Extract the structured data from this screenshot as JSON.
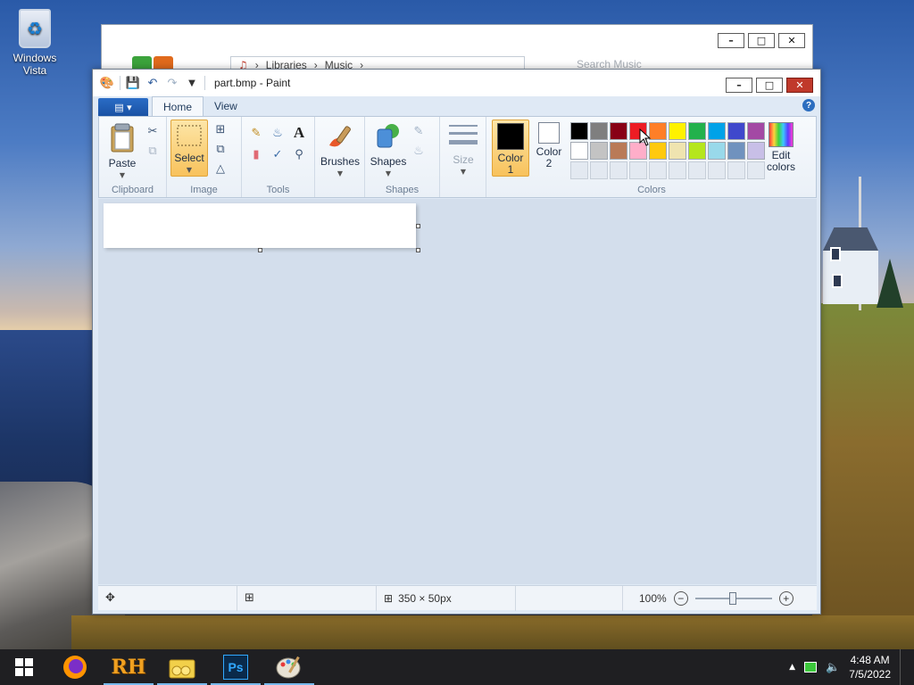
{
  "desktop": {
    "icon_label": "Windows Vista"
  },
  "explorer": {
    "breadcrumb": [
      "Libraries",
      "Music"
    ],
    "search_placeholder": "Search Music"
  },
  "paint": {
    "title": "part.bmp - Paint",
    "tabs": {
      "file_icon": "file-menu-icon",
      "home": "Home",
      "view": "View"
    },
    "clipboard": {
      "paste": "Paste",
      "label": "Clipboard"
    },
    "image": {
      "select": "Select",
      "label": "Image"
    },
    "tools": {
      "label": "Tools",
      "text_tool": "A"
    },
    "brushes": {
      "label": "Brushes"
    },
    "shapes": {
      "shapes_btn": "Shapes",
      "label": "Shapes"
    },
    "size": {
      "label": "Size"
    },
    "colors": {
      "color1_line1": "Color",
      "color1_line2": "1",
      "color2_line1": "Color",
      "color2_line2": "2",
      "edit_line1": "Edit",
      "edit_line2": "colors",
      "label": "Colors",
      "color1_value": "#000000",
      "color2_value": "#ffffff",
      "palette_row1": [
        "#000000",
        "#7f7f7f",
        "#880015",
        "#ed1c24",
        "#ff7f27",
        "#fff200",
        "#22b14c",
        "#00a2e8",
        "#3f48cc",
        "#a349a4"
      ],
      "palette_row2": [
        "#ffffff",
        "#c3c3c3",
        "#b97a57",
        "#ffaec9",
        "#ffc90e",
        "#efe4b0",
        "#b5e61d",
        "#99d9ea",
        "#7092be",
        "#c8bfe7"
      ]
    },
    "status": {
      "dimensions": "350 × 50px",
      "zoom": "100%"
    }
  },
  "taskbar": {
    "rh_label": "RH",
    "ps_label": "Ps",
    "time": "4:48 AM",
    "date": "7/5/2022"
  }
}
